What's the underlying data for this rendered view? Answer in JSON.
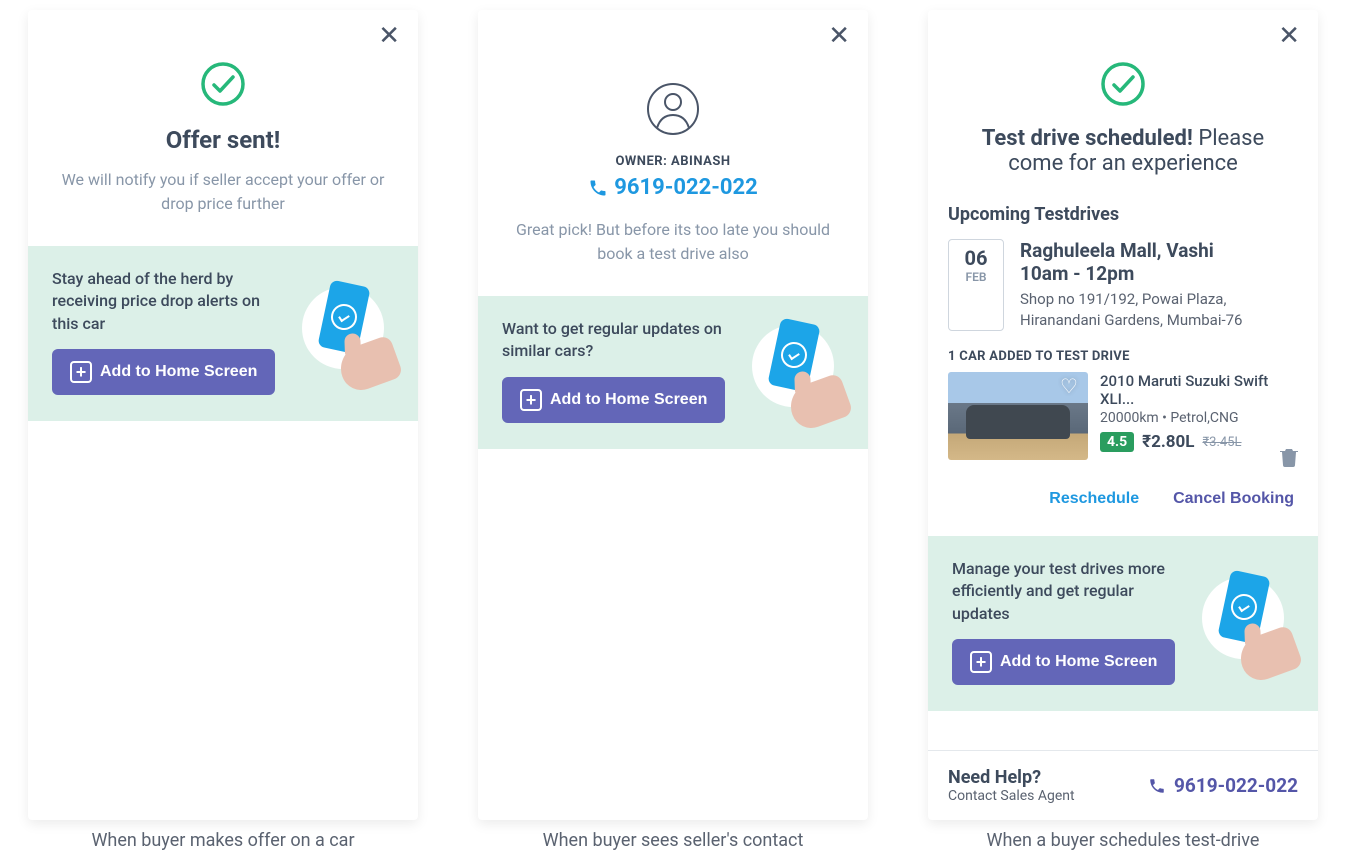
{
  "card1": {
    "title": "Offer sent!",
    "subtitle": "We will notify you if seller accept your offer or drop price further",
    "promo": "Stay ahead of the herd by receiving price drop alerts on this car",
    "cta": "Add to Home Screen",
    "caption": "When buyer makes offer on a car"
  },
  "card2": {
    "owner_label": "OWNER: ABINASH",
    "phone": "9619-022-022",
    "subtitle": "Great pick! But before its too late you should book a test drive also",
    "promo": "Want to get regular updates on similar cars?",
    "cta": "Add to Home Screen",
    "caption": "When buyer sees seller's contact"
  },
  "card3": {
    "title_bold": "Test drive scheduled!",
    "title_light": "Please come for an experience",
    "upcoming_heading": "Upcoming Testdrives",
    "date_day": "06",
    "date_month": "FEB",
    "location": "Raghuleela Mall, Vashi",
    "time": "10am - 12pm",
    "address": "Shop no 191/192, Powai Plaza, Hiranandani Gardens, Mumbai-76",
    "added_label": "1 CAR ADDED TO TEST DRIVE",
    "car_title": "2010 Maruti Suzuki Swift XLI...",
    "car_meta": "20000km • Petrol,CNG",
    "rating": "4.5",
    "price": "₹2.80L",
    "price_old": "₹3.45L",
    "reschedule": "Reschedule",
    "cancel": "Cancel Booking",
    "promo": "Manage your test drives more efficiently and get regular updates",
    "cta": "Add to Home Screen",
    "help_title": "Need Help?",
    "help_sub": "Contact Sales Agent",
    "help_phone": "9619-022-022",
    "caption": "When a buyer schedules test-drive"
  }
}
